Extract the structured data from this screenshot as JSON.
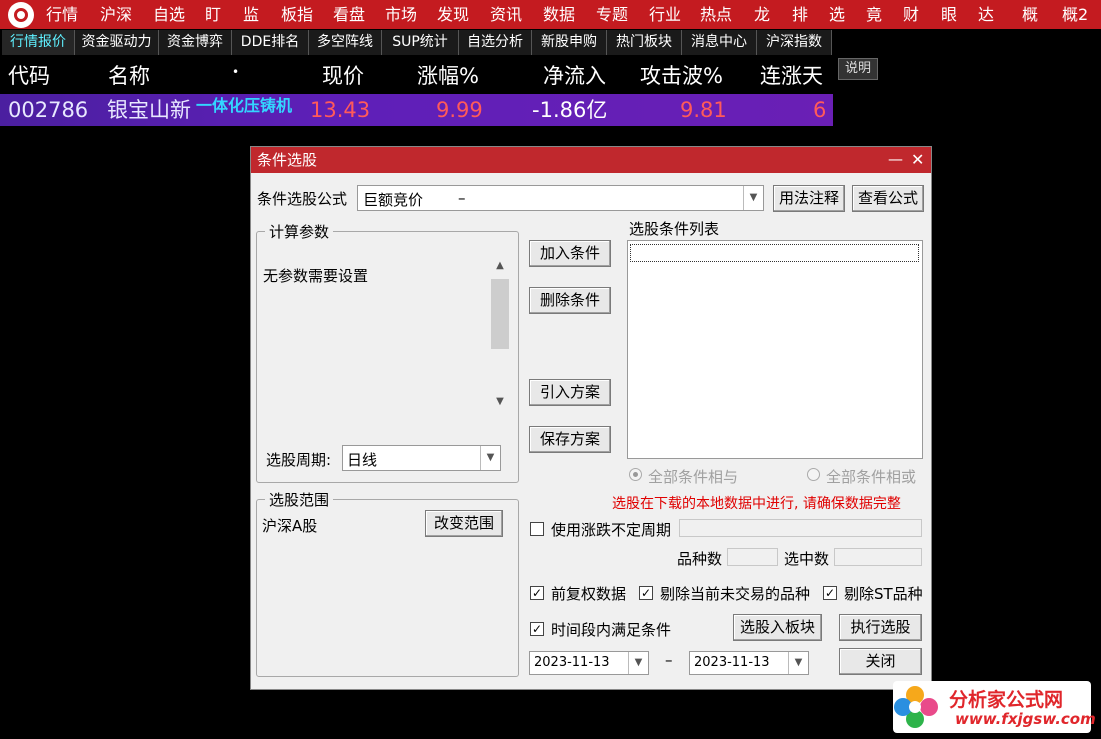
{
  "top_menu": [
    "行情",
    "沪深",
    "自选",
    "盯",
    "监",
    "板指",
    "看盘",
    "市场",
    "发现",
    "资讯",
    "数据",
    "专题",
    "行业",
    "热点",
    "龙",
    "排",
    "选",
    "竟",
    "财",
    "眼",
    "达",
    "概",
    "概2"
  ],
  "tabs": [
    "行情报价",
    "资金驱动力",
    "资金博弈",
    "DDE排名",
    "多空阵线",
    "SUP统计",
    "自选分析",
    "新股申购",
    "热门板块",
    "消息中心",
    "沪深指数"
  ],
  "table": {
    "headers": [
      "代码",
      "名称",
      "•",
      "现价",
      "涨幅%",
      "净流入",
      "攻击波%",
      "连涨天"
    ],
    "explain_label": "说明",
    "row": {
      "code": "002786",
      "name": "银宝山新",
      "concept": "一体化压铸机",
      "price": "13.43",
      "change": "9.99",
      "net_inflow": "-1.86亿",
      "attack": "9.81",
      "up_days": "6"
    }
  },
  "dialog": {
    "title": "条件选股",
    "formula_label": "条件选股公式",
    "formula_value": "巨额竞价",
    "formula_dash": "–",
    "usage_button": "用法注释",
    "view_formula_button": "查看公式",
    "params_group": "计算参数",
    "params_text": "无参数需要设置",
    "period_label": "选股周期:",
    "period_value": "日线",
    "condition_list_label": "选股条件列表",
    "add_condition": "加入条件",
    "delete_condition": "删除条件",
    "import_plan": "引入方案",
    "save_plan": "保存方案",
    "radio_and": "全部条件相与",
    "radio_or": "全部条件相或",
    "warning": "选股在下载的本地数据中进行, 请确保数据完整",
    "scope_group": "选股范围",
    "scope_value": "沪深A股",
    "change_scope": "改变范围",
    "variable_period": "使用涨跌不定周期",
    "variety_count": "品种数",
    "selected_count": "选中数",
    "pre_adjust": "前复权数据",
    "exclude_untraded": "剔除当前未交易的品种",
    "exclude_st": "剔除ST品种",
    "time_range": "时间段内满足条件",
    "select_to_block": "选股入板块",
    "execute": "执行选股",
    "close": "关闭",
    "date_from": "2023-11-13",
    "date_sep": "–",
    "date_to": "2023-11-13"
  },
  "watermark": {
    "text": "分析家公式网",
    "url": "www.fxjgsw.com"
  },
  "colors": {
    "menu_bg": "#c41b20",
    "row_bg": "#5e1fb8",
    "price_up": "#ff5a5a",
    "title_bg": "#c0282d",
    "warning": "#e00000",
    "concept": "#33d6ff"
  }
}
